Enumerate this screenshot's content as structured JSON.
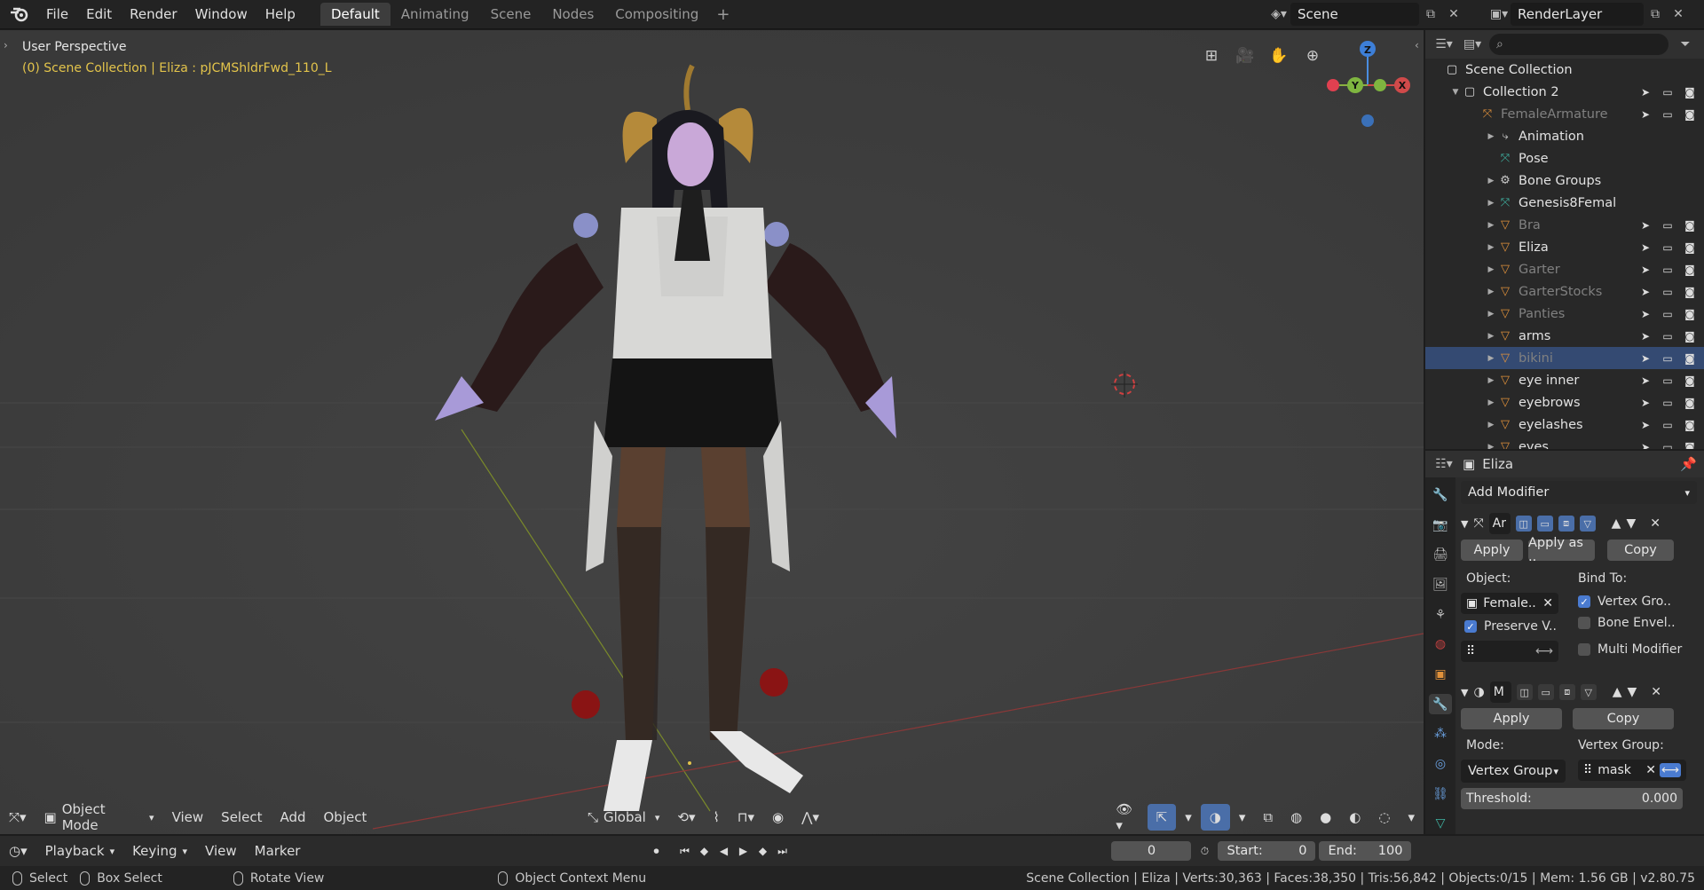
{
  "topbar": {
    "menus": [
      "File",
      "Edit",
      "Render",
      "Window",
      "Help"
    ],
    "workspaces": [
      "Default",
      "Animating",
      "Scene",
      "Nodes",
      "Compositing"
    ],
    "active_workspace": "Default",
    "scene_name": "Scene",
    "render_layer": "RenderLayer"
  },
  "viewport": {
    "perspective": "User Perspective",
    "context": "(0) Scene Collection | Eliza : pJCMShldrFwd_110_L",
    "toolbar": {
      "mode": "Object Mode",
      "menus": [
        "View",
        "Select",
        "Add",
        "Object"
      ],
      "orientation": "Global"
    },
    "gizmo": {
      "z": "Z",
      "y": "Y",
      "x": "X"
    }
  },
  "outliner": {
    "root": "Scene Collection",
    "items": [
      {
        "label": "Collection 2",
        "icon": "collection-icon",
        "indent": 1,
        "arrow": "▼",
        "dim": false,
        "sel": false
      },
      {
        "label": "FemaleArmature",
        "icon": "armature-icon",
        "indent": 2,
        "arrow": "",
        "dim": true,
        "sel": false
      },
      {
        "label": "Animation",
        "icon": "animation-icon",
        "indent": 3,
        "arrow": "▶",
        "dim": false,
        "sel": false
      },
      {
        "label": "Pose",
        "icon": "pose-icon",
        "indent": 3,
        "arrow": "",
        "dim": false,
        "sel": false
      },
      {
        "label": "Bone Groups",
        "icon": "bone-groups-icon",
        "indent": 3,
        "arrow": "▶",
        "dim": false,
        "sel": false
      },
      {
        "label": "Genesis8Femal",
        "icon": "armature-data-icon",
        "indent": 3,
        "arrow": "▶",
        "dim": false,
        "sel": false
      },
      {
        "label": "Bra",
        "icon": "mesh-icon",
        "indent": 3,
        "arrow": "▶",
        "dim": true,
        "sel": false
      },
      {
        "label": "Eliza",
        "icon": "mesh-icon",
        "indent": 3,
        "arrow": "▶",
        "dim": false,
        "sel": false
      },
      {
        "label": "Garter",
        "icon": "mesh-icon",
        "indent": 3,
        "arrow": "▶",
        "dim": true,
        "sel": false
      },
      {
        "label": "GarterStocks",
        "icon": "mesh-icon",
        "indent": 3,
        "arrow": "▶",
        "dim": true,
        "sel": false
      },
      {
        "label": "Panties",
        "icon": "mesh-icon",
        "indent": 3,
        "arrow": "▶",
        "dim": true,
        "sel": false
      },
      {
        "label": "arms",
        "icon": "mesh-icon",
        "indent": 3,
        "arrow": "▶",
        "dim": false,
        "sel": false
      },
      {
        "label": "bikini",
        "icon": "mesh-icon",
        "indent": 3,
        "arrow": "▶",
        "dim": true,
        "sel": true
      },
      {
        "label": "eye inner",
        "icon": "mesh-icon",
        "indent": 3,
        "arrow": "▶",
        "dim": false,
        "sel": false
      },
      {
        "label": "eyebrows",
        "icon": "mesh-icon",
        "indent": 3,
        "arrow": "▶",
        "dim": false,
        "sel": false
      },
      {
        "label": "eyelashes",
        "icon": "mesh-icon",
        "indent": 3,
        "arrow": "▶",
        "dim": false,
        "sel": false
      },
      {
        "label": "eyes",
        "icon": "mesh-icon",
        "indent": 3,
        "arrow": "▶",
        "dim": false,
        "sel": false
      }
    ]
  },
  "properties": {
    "object_name": "Eliza",
    "add_modifier": "Add Modifier",
    "armature_mod": {
      "name": "Ar",
      "apply": "Apply",
      "apply_as": "Apply as ..",
      "copy": "Copy",
      "object_label": "Object:",
      "object_value": "Female..",
      "bind_to": "Bind To:",
      "vertex_groups": "Vertex Gro..",
      "preserve": "Preserve V..",
      "bone_env": "Bone Envel..",
      "multi_mod": "Multi Modifier"
    },
    "mask_mod": {
      "name": "M",
      "apply": "Apply",
      "copy": "Copy",
      "mode_label": "Mode:",
      "mode_value": "Vertex Group",
      "vg_label": "Vertex Group:",
      "vg_value": "mask",
      "threshold_label": "Threshold:",
      "threshold_value": "0.000"
    }
  },
  "timeline": {
    "menus": [
      "Playback",
      "Keying",
      "View",
      "Marker"
    ],
    "current_frame": "0",
    "start_label": "Start:",
    "start_value": "0",
    "end_label": "End:",
    "end_value": "100"
  },
  "statusbar": {
    "select": "Select",
    "box_select": "Box Select",
    "rotate_view": "Rotate View",
    "context_menu": "Object Context Menu",
    "stats": "Scene Collection | Eliza | Verts:30,363 | Faces:38,350 | Tris:56,842 | Objects:0/15 | Mem: 1.56 GB | v2.80.75"
  },
  "colors": {
    "accent": "#4a7bd0",
    "selection": "#344a72",
    "context_text": "#e3c44b",
    "mesh_icon": "#e0913b",
    "armature_icon": "#3fb5a4"
  }
}
